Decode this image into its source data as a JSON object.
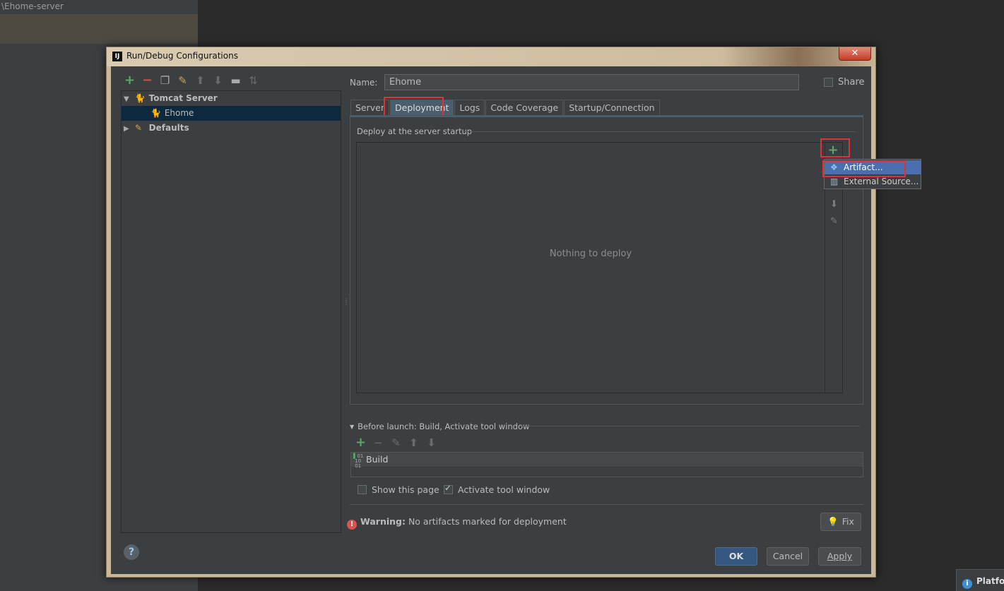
{
  "background": {
    "path_text": "\\Ehome-server",
    "notification_text": "Platfo"
  },
  "dialog": {
    "title": "Run/Debug Configurations",
    "app_icon_text": "IJ",
    "close_symbol": "✕"
  },
  "left_toolbar": {
    "icons": [
      "add-icon",
      "remove-icon",
      "copy-icon",
      "wrench-icon",
      "move-up-icon",
      "move-down-icon",
      "folder-icon",
      "sort-icon"
    ]
  },
  "tree": {
    "items": [
      {
        "label": "Tomcat Server",
        "expanded": true,
        "bold": true
      },
      {
        "label": "Ehome",
        "selected": true
      },
      {
        "label": "Defaults",
        "expanded": false,
        "bold": true
      }
    ]
  },
  "name_field": {
    "label": "Name:",
    "value": "Ehome"
  },
  "share": {
    "label": "Share",
    "checked": false
  },
  "tabs": [
    {
      "label": "Server",
      "active": false
    },
    {
      "label": "Deployment",
      "active": true
    },
    {
      "label": "Logs",
      "active": false
    },
    {
      "label": "Code Coverage",
      "active": false
    },
    {
      "label": "Startup/Connection",
      "active": false
    }
  ],
  "deployment": {
    "group_title": "Deploy at the server startup",
    "empty_text": "Nothing to deploy",
    "add_symbol": "+",
    "popup_items": [
      {
        "label": "Artifact...",
        "selected": true,
        "icon": "artifact-icon"
      },
      {
        "label": "External Source...",
        "selected": false,
        "icon": "external-source-icon"
      }
    ]
  },
  "before_launch": {
    "title": "Before launch: Build, Activate tool window",
    "tasks": [
      {
        "label": "Build"
      }
    ]
  },
  "options": {
    "show_page": {
      "label": "Show this page",
      "checked": false
    },
    "activate_tool": {
      "label": "Activate tool window",
      "checked": true
    }
  },
  "warning": {
    "bold": "Warning:",
    "text": " No artifacts marked for deployment",
    "fix_label": "Fix"
  },
  "buttons": {
    "ok": "OK",
    "cancel": "Cancel",
    "apply": "Apply",
    "help": "?"
  },
  "colors": {
    "accent_green": "#59a869",
    "remove_red": "#c75450",
    "highlight_red": "#e0303a",
    "selection_blue": "#4b6eaf",
    "tree_selection": "#0d293e"
  }
}
